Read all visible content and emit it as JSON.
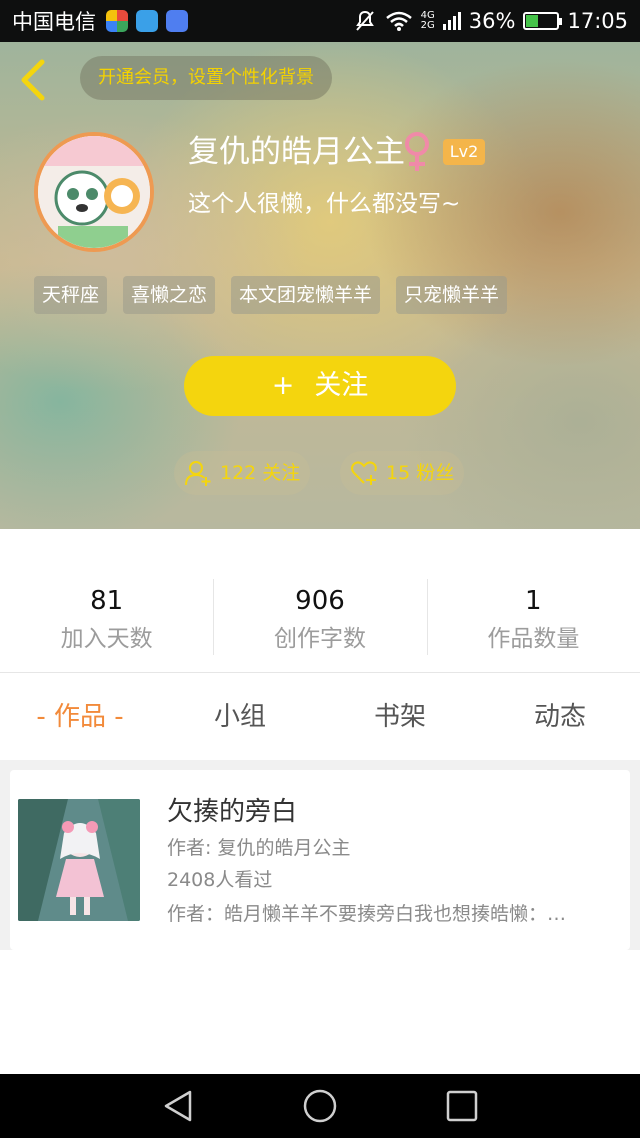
{
  "status_bar": {
    "carrier": "中国电信",
    "network_top": "4G",
    "network_bottom": "2G",
    "battery": "36%",
    "time": "17:05"
  },
  "header": {
    "vip_banner": "开通会员，设置个性化背景",
    "nickname": "复仇的皓月公主",
    "level": "Lv2",
    "bio": "这个人很懒，什么都没写~",
    "tags": [
      "天秤座",
      "喜懒之恋",
      "本文团宠懒羊羊",
      "只宠懒羊羊"
    ],
    "follow_plus": "+",
    "follow_label": "关注",
    "following_count": "122 关注",
    "fans_count": "15 粉丝"
  },
  "stats": [
    {
      "value": "81",
      "label": "加入天数"
    },
    {
      "value": "906",
      "label": "创作字数"
    },
    {
      "value": "1",
      "label": "作品数量"
    }
  ],
  "tabs": [
    "- 作品 -",
    "小组",
    "书架",
    "动态"
  ],
  "works": [
    {
      "title": "欠揍的旁白",
      "author": "作者: 复仇的皓月公主",
      "views": "2408人看过",
      "intro": "作者：皓月懒羊羊不要揍旁白我也想揍皓懒：…"
    }
  ],
  "colors": {
    "accent_yellow": "#f4d50e",
    "tab_active": "#f28a3a",
    "level_badge": "#f4b54a",
    "gender_pink": "#f08aa8"
  },
  "icons": {
    "back": "chevron-left-icon",
    "gender": "female-icon",
    "following": "user-add-icon",
    "fans": "heart-add-icon",
    "nav_back": "triangle-back-icon",
    "nav_home": "circle-home-icon",
    "nav_recent": "square-recent-icon"
  }
}
